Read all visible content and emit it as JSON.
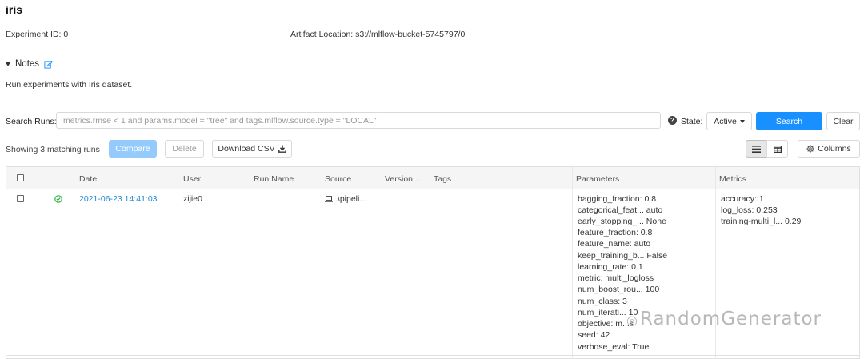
{
  "experiment": {
    "title": "iris",
    "id_label": "Experiment ID:",
    "id_value": "0",
    "artifact_label": "Artifact Location:",
    "artifact_value": "s3://mlflow-bucket-5745797/0"
  },
  "notes": {
    "label": "Notes",
    "text": "Run experiments with Iris dataset."
  },
  "search": {
    "label": "Search Runs:",
    "placeholder": "metrics.rmse < 1 and params.model = \"tree\" and tags.mlflow.source.type = \"LOCAL\"",
    "value": "",
    "state_label": "State:",
    "state_value": "Active",
    "search_button": "Search",
    "clear_button": "Clear"
  },
  "toolbar": {
    "showing": "Showing 3 matching runs",
    "compare": "Compare",
    "delete": "Delete",
    "download": "Download CSV",
    "columns": "Columns"
  },
  "table": {
    "headers": {
      "date": "Date",
      "user": "User",
      "run_name": "Run Name",
      "source": "Source",
      "version": "Version...",
      "tags": "Tags",
      "parameters": "Parameters",
      "metrics": "Metrics"
    },
    "rows": [
      {
        "date": "2021-06-23 14:41:03",
        "user": "zijie0",
        "run_name": "",
        "source": ".\\pipeli...",
        "version": "",
        "status": "finished",
        "parameters": [
          "bagging_fraction: 0.8",
          "categorical_feat...  auto",
          "early_stopping_...  None",
          "feature_fraction: 0.8",
          "feature_name: auto",
          "keep_training_b...  False",
          "learning_rate: 0.1",
          "metric: multi_logloss",
          "num_boost_rou...  100",
          "num_class: 3",
          "num_iterati...  10",
          "objective: m...s",
          "seed: 42",
          "verbose_eval: True"
        ],
        "metrics": [
          "accuracy: 1",
          "log_loss: 0.253",
          "training-multi_l...  0.29"
        ]
      }
    ]
  },
  "watermark": "RandomGenerator",
  "colors": {
    "primary": "#1890ff",
    "link": "#1e88d4",
    "success": "#2fb344"
  }
}
